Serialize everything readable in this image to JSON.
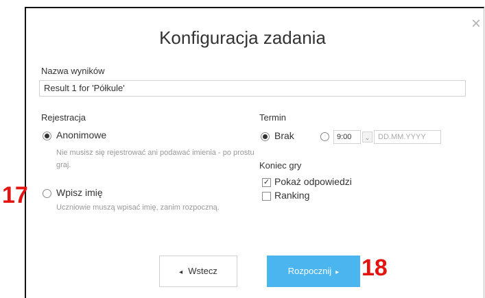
{
  "dialog": {
    "title": "Konfiguracja zadania",
    "close_symbol": "×"
  },
  "results_name": {
    "label": "Nazwa wyników",
    "value": "Result 1 for 'Półkule'"
  },
  "registration": {
    "label": "Rejestracja",
    "options": [
      {
        "label": "Anonimowe",
        "selected": true,
        "hint": "Nie musisz się rejestrować ani podawać imienia - po prostu graj."
      },
      {
        "label": "Wpisz imię",
        "selected": false,
        "hint": "Uczniowie muszą wpisać imię, zanim rozpoczną."
      }
    ]
  },
  "deadline": {
    "label": "Termin",
    "none_label": "Brak",
    "none_selected": true,
    "time_value": "9:00",
    "time_dropdown_icon": "chevron-down-icon",
    "date_placeholder": "DD.MM.YYYY"
  },
  "game_end": {
    "label": "Koniec gry",
    "options": [
      {
        "label": "Pokaż odpowiedzi",
        "checked": true
      },
      {
        "label": "Ranking",
        "checked": false
      }
    ]
  },
  "buttons": {
    "back_label": "Wstecz",
    "back_icon": "◂",
    "start_label": "Rozpocznij",
    "start_icon": "▸",
    "start_color": "#4ab5ee"
  },
  "annotations": {
    "step_17": "17",
    "step_18": "18",
    "color": "#e3140f"
  }
}
